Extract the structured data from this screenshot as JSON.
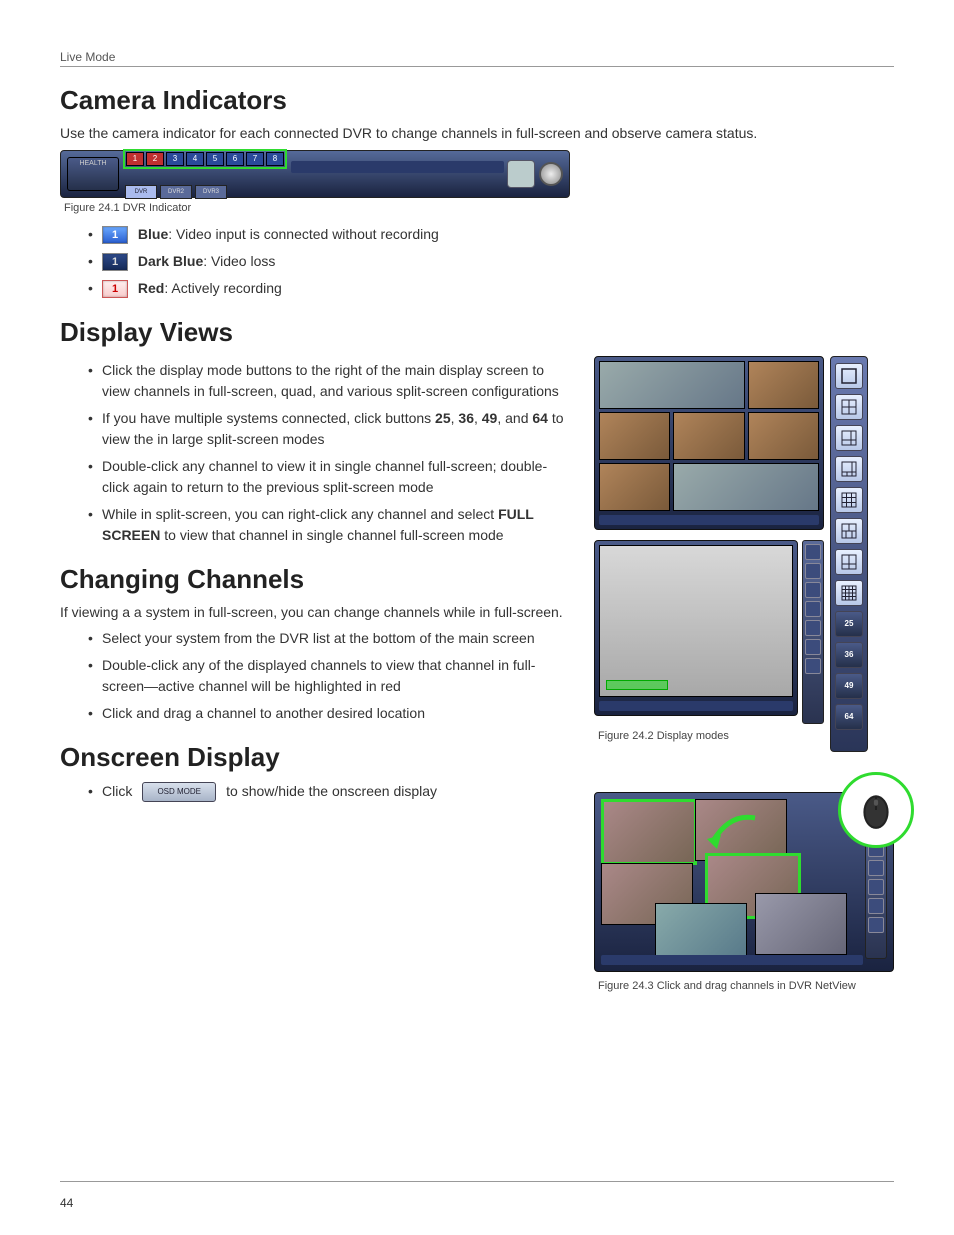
{
  "header": {
    "section": "Live Mode"
  },
  "h_camera": "Camera Indicators",
  "camera_intro": "Use the camera indicator for each connected DVR to change channels in full-screen and observe camera status.",
  "fig1": {
    "caption": "Figure 24.1 DVR Indicator",
    "health": "HEALTH",
    "channels": [
      "1",
      "2",
      "3",
      "4",
      "5",
      "6",
      "7",
      "8"
    ],
    "tabs": [
      "DVR",
      "DVR2",
      "DVR3"
    ]
  },
  "indicator_items": [
    {
      "color": "blue",
      "label": "Blue",
      "desc": ": Video input is connected without recording"
    },
    {
      "color": "dblue",
      "label": "Dark Blue",
      "desc": ": Video loss"
    },
    {
      "color": "red",
      "label": "Red",
      "desc": ": Actively recording"
    }
  ],
  "h_display": "Display Views",
  "display_items": [
    "Click the display mode buttons to the right of the main display screen to view channels in full-screen, quad, and various split-screen configurations",
    "If you have multiple systems connected, click buttons 25, 36, 49, and 64 to view the in large split-screen modes",
    "Double-click any channel to view it in single channel full-screen; double-click again to return to the previous split-screen mode",
    "While in split-screen, you can right-click any channel and select FULL SCREEN to view that channel in single channel full-screen mode"
  ],
  "h_changing": "Changing Channels",
  "changing_intro": "If viewing a a system in full-screen, you can change channels while in full-screen.",
  "changing_items": [
    "Select your system from the DVR list at the bottom of the main screen",
    "Double-click any of the displayed channels to view that channel in full-screen—active channel will be highlighted in red",
    "Click and drag a channel to another desired location"
  ],
  "h_onscreen": "Onscreen Display",
  "osd_pre": "Click",
  "osd_btn": "OSD MODE",
  "osd_post": "to show/hide the onscreen display",
  "fig2": {
    "caption": "Figure 24.2 Display modes",
    "mode_numbers": [
      "25",
      "36",
      "49",
      "64"
    ]
  },
  "fig3": {
    "caption": "Figure 24.3 Click and drag channels in DVR NetView"
  },
  "page_number": "44"
}
